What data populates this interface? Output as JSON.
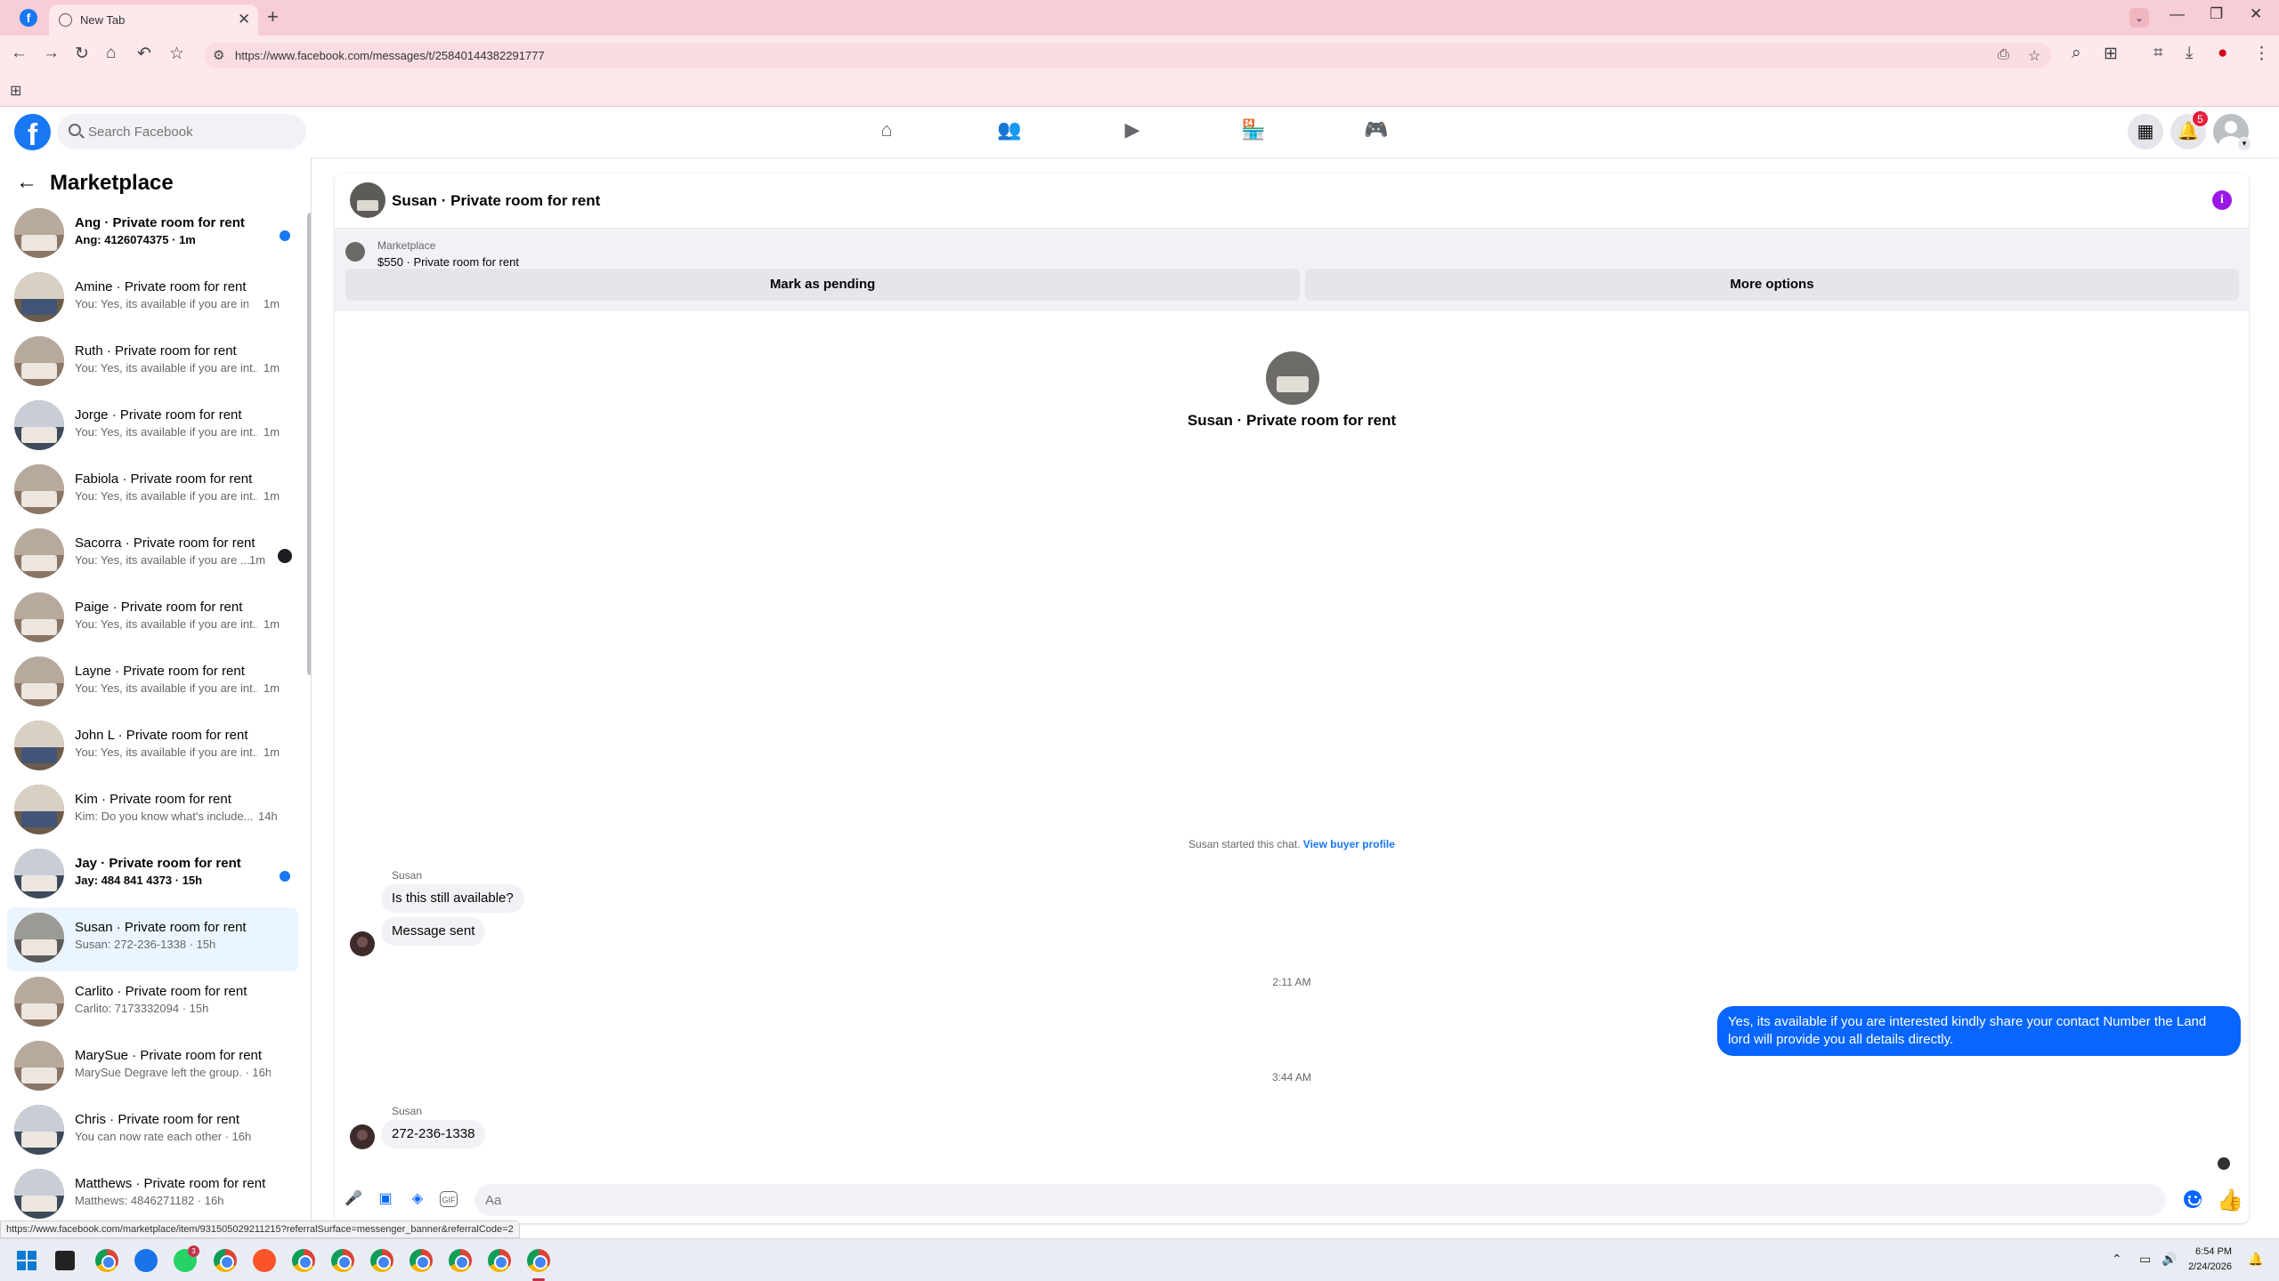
{
  "browser": {
    "tab_title": "New Tab",
    "url": "https://www.facebook.com/messages/t/25840144382291777",
    "status_link": "https://www.facebook.com/marketplace/item/931505029211215?referralSurface=messenger_banner&referralCode=2"
  },
  "fb_header": {
    "logo_letter": "f",
    "search_placeholder": "Search Facebook",
    "notification_count": "5",
    "nav_icons": [
      "home-icon",
      "friends-icon",
      "video-icon",
      "marketplace-icon",
      "gaming-icon"
    ]
  },
  "sidebar": {
    "title": "Marketplace",
    "conversations": [
      {
        "title": "Ang · Private room for rent",
        "subtitle": "Ang: 4126074375 · 1m"
      },
      {
        "title": "Amine · Private room for rent",
        "subtitle": "You: Yes, its available if you are int...",
        "time": "1m"
      },
      {
        "title": "Ruth · Private room for rent",
        "subtitle": "You: Yes, its available if you are int...",
        "time": "1m"
      },
      {
        "title": "Jorge · Private room for rent",
        "subtitle": "You: Yes, its available if you are int...",
        "time": "1m"
      },
      {
        "title": "Fabiola · Private room for rent",
        "subtitle": "You: Yes, its available if you are int...",
        "time": "1m"
      },
      {
        "title": "Sacorra · Private room for rent",
        "subtitle": "You: Yes, its available if you are ...",
        "time": "1m"
      },
      {
        "title": "Paige · Private room for rent",
        "subtitle": "You: Yes, its available if you are int...",
        "time": "1m"
      },
      {
        "title": "Layne · Private room for rent",
        "subtitle": "You: Yes, its available if you are int...",
        "time": "1m"
      },
      {
        "title": "John L · Private room for rent",
        "subtitle": "You: Yes, its available if you are int...",
        "time": "1m"
      },
      {
        "title": "Kim · Private room for rent",
        "subtitle": "Kim: Do you know what's include...",
        "time": "14h"
      },
      {
        "title": "Jay · Private room for rent",
        "subtitle": "Jay: 484 841 4373 · 15h"
      },
      {
        "title": "Susan · Private room for rent",
        "subtitle": "Susan: 272-236-1338 · 15h"
      },
      {
        "title": "Carlito · Private room for rent",
        "subtitle": "Carlito: 7173332094 · 15h"
      },
      {
        "title": "MarySue · Private room for rent",
        "subtitle": "MarySue Degrave left the group. · 16h"
      },
      {
        "title": "Chris · Private room for rent",
        "subtitle": "You can now rate each other · 16h"
      },
      {
        "title": "Matthews · Private room for rent",
        "subtitle": "Matthews: 4846271182 · 16h"
      }
    ]
  },
  "chat": {
    "header_title": "Susan · Private room for rent",
    "marketplace_label": "Marketplace",
    "listing": "$550 · Private room for rent",
    "mark_pending_label": "Mark as pending",
    "more_options_label": "More options",
    "intro_title": "Susan · Private room for rent",
    "started_text": "Susan started this chat.",
    "view_profile_label": "View buyer profile",
    "sender_name_1": "Susan",
    "message_1": "Is this still available?",
    "message_2": "Message sent",
    "timestamp_1": "2:11 AM",
    "outgoing_message": "Yes, its available if you are interested kindly share your contact Number the Land lord will provide you all details directly.",
    "timestamp_2": "3:44 AM",
    "sender_name_2": "Susan",
    "message_3": "272-236-1338",
    "composer_placeholder": "Aa"
  },
  "taskbar": {
    "time": "6:54 PM",
    "date": "2/24/2026",
    "badge_count": "3"
  },
  "colors": {
    "brand_blue": "#1877f2",
    "message_blue": "#0866ff",
    "tab_strip": "#f7cdd6",
    "info_purple": "#9b19e6"
  }
}
